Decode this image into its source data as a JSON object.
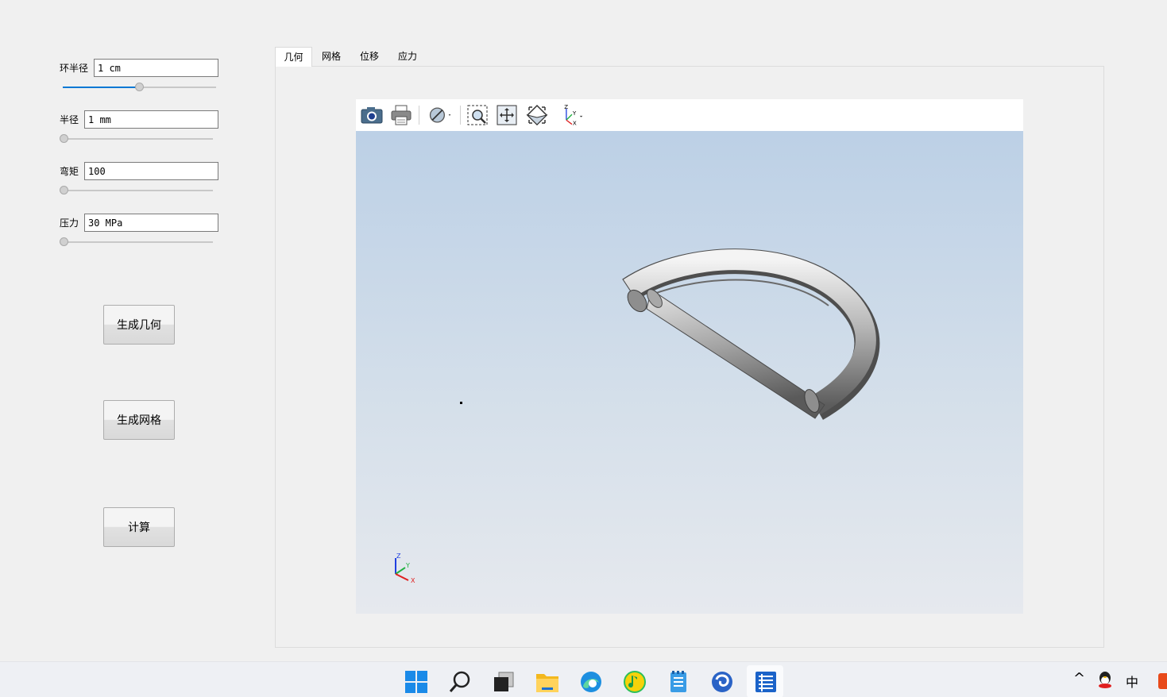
{
  "params": [
    {
      "label": "环半径",
      "value": "1 cm",
      "slider_fraction": 0.5
    },
    {
      "label": "半径",
      "value": "1 mm",
      "slider_fraction": 0.0
    },
    {
      "label": "弯矩",
      "value": "100",
      "slider_fraction": 0.0
    },
    {
      "label": "压力",
      "value": "30 MPa",
      "slider_fraction": 0.0
    }
  ],
  "buttons": {
    "generate_geometry": "生成几何",
    "generate_mesh": "生成网格",
    "compute": "计算"
  },
  "tabs": [
    {
      "label": "几何",
      "active": true
    },
    {
      "label": "网格",
      "active": false
    },
    {
      "label": "位移",
      "active": false
    },
    {
      "label": "应力",
      "active": false
    }
  ],
  "viewer": {
    "toolbar_icons": [
      "camera-icon",
      "print-icon",
      "clip-plane-icon",
      "zoom-box-icon",
      "fit-all-icon",
      "view-iso-icon",
      "axes-orientation-icon"
    ],
    "axis_labels": {
      "z": "Z",
      "y": "Y",
      "x": "X"
    },
    "colors": {
      "axis_x": "#e02020",
      "axis_y": "#20b040",
      "axis_z": "#2040e0"
    }
  },
  "taskbar": {
    "icons": [
      "windows-start-icon",
      "search-icon",
      "task-view-icon",
      "file-explorer-icon",
      "edge-browser-icon",
      "qq-music-icon",
      "notepad-icon",
      "app-swirl-icon",
      "active-app-icon"
    ],
    "tray": {
      "chevron": "^",
      "ime": "中"
    }
  }
}
